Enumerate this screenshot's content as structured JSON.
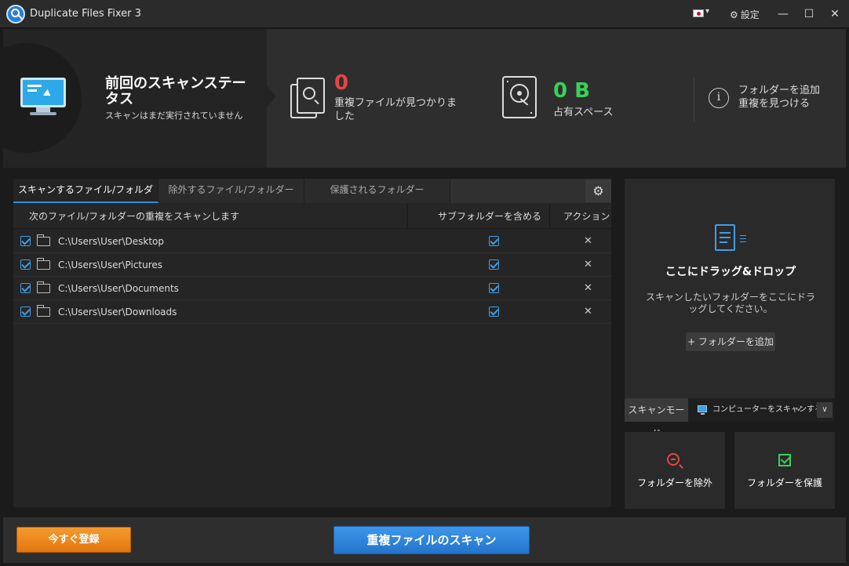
{
  "window": {
    "title": "Duplicate Files Fixer 3",
    "settings_label": "設定",
    "language_flag": "jp-flag-icon"
  },
  "header": {
    "scan_status_title": "前回のスキャンステータス",
    "scan_status_sub": "スキャンはまだ実行されていません",
    "duplicates_value": "0",
    "duplicates_label": "重複ファイルが見つかりました",
    "space_value": "0 B",
    "space_label": "占有スペース",
    "info_line1": "フォルダーを追加",
    "info_line2": "重複を見つける"
  },
  "tabs": [
    {
      "label": "スキャンするファイル/フォルダー",
      "active": true
    },
    {
      "label": "除外するファイル/フォルダー",
      "active": false
    },
    {
      "label": "保護されるフォルダー",
      "active": false
    }
  ],
  "table": {
    "col_path": "次のファイル/フォルダーの重複をスキャンします",
    "col_subfolders": "サブフォルダーを含める",
    "col_action": "アクション",
    "rows": [
      {
        "path": "C:\\Users\\User\\Desktop",
        "checked": true,
        "include_subfolders": true
      },
      {
        "path": "C:\\Users\\User\\Pictures",
        "checked": true,
        "include_subfolders": true
      },
      {
        "path": "C:\\Users\\User\\Documents",
        "checked": true,
        "include_subfolders": true
      },
      {
        "path": "C:\\Users\\User\\Downloads",
        "checked": true,
        "include_subfolders": true
      }
    ]
  },
  "drop": {
    "title": "ここにドラッグ&ドロップ",
    "desc": "スキャンしたいフォルダーをここにドラッグしてください。",
    "add_button": "+ フォルダーを追加"
  },
  "scan_mode": {
    "label": "スキャンモード",
    "value": "コンピューターをスキャンする"
  },
  "actions": {
    "exclude": "フォルダーを除外",
    "protect": "フォルダーを保護"
  },
  "footer": {
    "register": "今すぐ登録",
    "scan": "重複ファイルのスキャン"
  },
  "colors": {
    "accent": "#2e8ee0",
    "duplicates": "#e64545",
    "space": "#3ad05a",
    "register": "#f08a1f"
  }
}
